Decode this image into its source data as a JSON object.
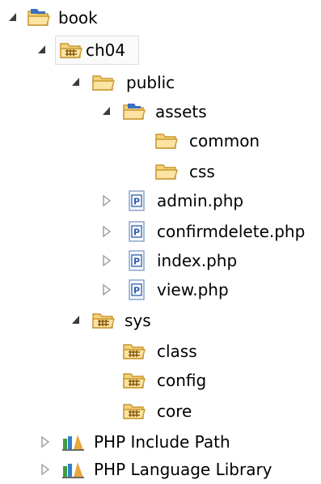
{
  "tree": {
    "nodes": [
      {
        "label": "book",
        "icon": "project-folder-icon",
        "toggle": "expanded"
      },
      {
        "label": "ch04",
        "icon": "package-folder-icon",
        "toggle": "expanded",
        "selected": true
      },
      {
        "label": "public",
        "icon": "folder-icon",
        "toggle": "expanded"
      },
      {
        "label": "assets",
        "icon": "folder-icon",
        "toggle": "expanded"
      },
      {
        "label": "common",
        "icon": "folder-icon",
        "toggle": "none"
      },
      {
        "label": "css",
        "icon": "folder-icon",
        "toggle": "none"
      },
      {
        "label": "admin.php",
        "icon": "php-file-icon",
        "toggle": "collapsed"
      },
      {
        "label": "confirmdelete.php",
        "icon": "php-file-icon",
        "toggle": "collapsed"
      },
      {
        "label": "index.php",
        "icon": "php-file-icon",
        "toggle": "collapsed"
      },
      {
        "label": "view.php",
        "icon": "php-file-icon",
        "toggle": "collapsed"
      },
      {
        "label": "sys",
        "icon": "package-folder-icon",
        "toggle": "expanded"
      },
      {
        "label": "class",
        "icon": "package-folder-icon",
        "toggle": "none"
      },
      {
        "label": "config",
        "icon": "package-folder-icon",
        "toggle": "none"
      },
      {
        "label": "core",
        "icon": "package-folder-icon",
        "toggle": "none"
      },
      {
        "label": "PHP Include Path",
        "icon": "library-icon",
        "toggle": "collapsed"
      },
      {
        "label": "PHP Language Library",
        "icon": "library-icon",
        "toggle": "collapsed"
      }
    ]
  },
  "colors": {
    "folder_fill": "#f5d27a",
    "folder_edge": "#c8962e",
    "project_blue": "#3a6fc4",
    "php_blue": "#2f5fa8",
    "toggle_dark": "#3c3c3c",
    "toggle_light": "#9a9a9a"
  }
}
